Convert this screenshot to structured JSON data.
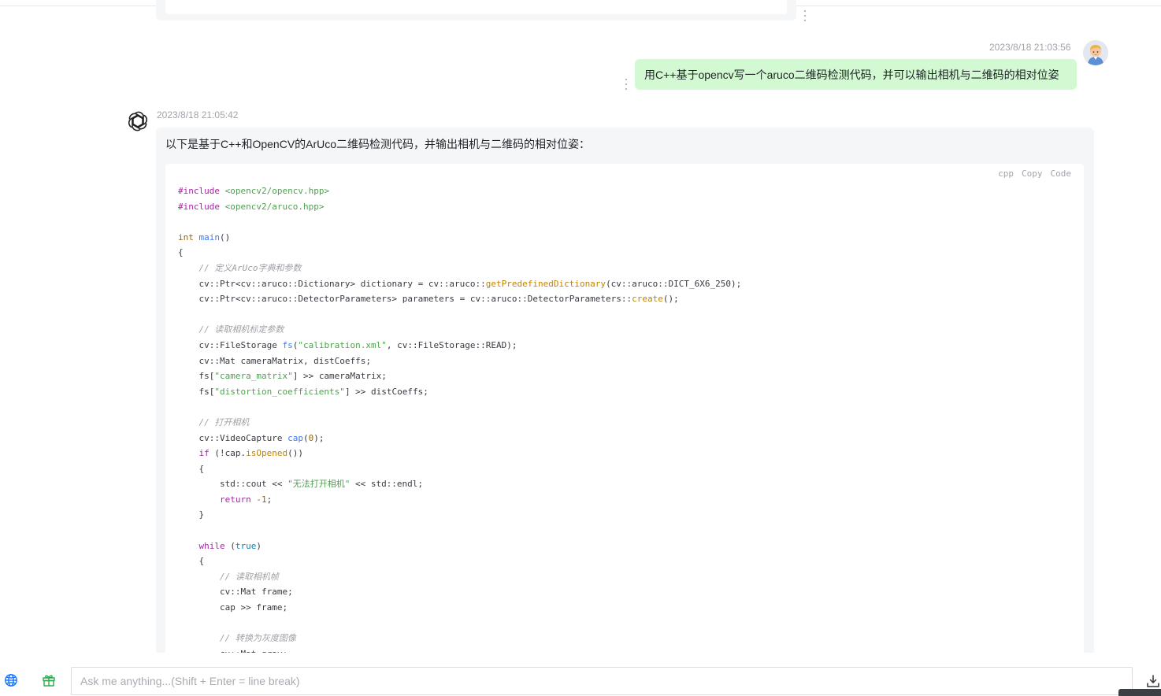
{
  "previous_message": {},
  "user_message": {
    "timestamp": "2023/8/18 21:03:56",
    "text": "用C++基于opencv写一个aruco二维码检测代码，并可以输出相机与二维码的相对位姿",
    "bubble_color": "#d2f9d1"
  },
  "bot_message": {
    "timestamp": "2023/8/18 21:05:42",
    "intro": "以下是基于C++和OpenCV的ArUco二维码检测代码，并输出相机与二维码的相对位姿：",
    "code": {
      "language_label": "cpp",
      "copy_label": "Copy",
      "code_label": "Code",
      "lines": [
        [
          [
            "kw",
            "#include"
          ],
          [
            "p",
            " "
          ],
          [
            "str",
            "<opencv2/opencv.hpp>"
          ]
        ],
        [
          [
            "kw",
            "#include"
          ],
          [
            "p",
            " "
          ],
          [
            "str",
            "<opencv2/aruco.hpp>"
          ]
        ],
        [],
        [
          [
            "type",
            "int"
          ],
          [
            "p",
            " "
          ],
          [
            "fn",
            "main"
          ],
          [
            "p",
            "()"
          ]
        ],
        [
          [
            "p",
            "{"
          ]
        ],
        [
          [
            "p",
            "    "
          ],
          [
            "com",
            "// 定义ArUco字典和参数"
          ]
        ],
        [
          [
            "p",
            "    cv::Ptr<cv::aruco::Dictionary> dictionary = cv::aruco::"
          ],
          [
            "fn2",
            "getPredefinedDictionary"
          ],
          [
            "p",
            "(cv::aruco::DICT_6X6_250);"
          ]
        ],
        [
          [
            "p",
            "    cv::Ptr<cv::aruco::DetectorParameters> parameters = cv::aruco::DetectorParameters::"
          ],
          [
            "fn2",
            "create"
          ],
          [
            "p",
            "();"
          ]
        ],
        [],
        [
          [
            "p",
            "    "
          ],
          [
            "com",
            "// 读取相机标定参数"
          ]
        ],
        [
          [
            "p",
            "    cv::FileStorage "
          ],
          [
            "fn",
            "fs"
          ],
          [
            "p",
            "("
          ],
          [
            "str",
            "\"calibration.xml\""
          ],
          [
            "p",
            ", cv::FileStorage::READ);"
          ]
        ],
        [
          [
            "p",
            "    cv::Mat cameraMatrix, distCoeffs;"
          ]
        ],
        [
          [
            "p",
            "    fs["
          ],
          [
            "str",
            "\"camera_matrix\""
          ],
          [
            "p",
            "] >> cameraMatrix;"
          ]
        ],
        [
          [
            "p",
            "    fs["
          ],
          [
            "str",
            "\"distortion_coefficients\""
          ],
          [
            "p",
            "] >> distCoeffs;"
          ]
        ],
        [],
        [
          [
            "p",
            "    "
          ],
          [
            "com",
            "// 打开相机"
          ]
        ],
        [
          [
            "p",
            "    cv::VideoCapture "
          ],
          [
            "fn",
            "cap"
          ],
          [
            "p",
            "("
          ],
          [
            "num",
            "0"
          ],
          [
            "p",
            ");"
          ]
        ],
        [
          [
            "p",
            "    "
          ],
          [
            "kw",
            "if"
          ],
          [
            "p",
            " (!cap."
          ],
          [
            "fn2",
            "isOpened"
          ],
          [
            "p",
            "())"
          ]
        ],
        [
          [
            "p",
            "    {"
          ]
        ],
        [
          [
            "p",
            "        std::cout << "
          ],
          [
            "str",
            "\"无法打开相机\""
          ],
          [
            "p",
            " << std::endl;"
          ]
        ],
        [
          [
            "p",
            "        "
          ],
          [
            "kw",
            "return"
          ],
          [
            "p",
            " "
          ],
          [
            "num",
            "-1"
          ],
          [
            "p",
            ";"
          ]
        ],
        [
          [
            "p",
            "    }"
          ]
        ],
        [],
        [
          [
            "p",
            "    "
          ],
          [
            "kw",
            "while"
          ],
          [
            "p",
            " ("
          ],
          [
            "lit",
            "true"
          ],
          [
            "p",
            ")"
          ]
        ],
        [
          [
            "p",
            "    {"
          ]
        ],
        [
          [
            "p",
            "        "
          ],
          [
            "com",
            "// 读取相机帧"
          ]
        ],
        [
          [
            "p",
            "        cv::Mat frame;"
          ]
        ],
        [
          [
            "p",
            "        cap >> frame;"
          ]
        ],
        [],
        [
          [
            "p",
            "        "
          ],
          [
            "com",
            "// 转换为灰度图像"
          ]
        ],
        [
          [
            "p",
            "        cv::Mat gray;"
          ]
        ]
      ]
    }
  },
  "input_bar": {
    "placeholder": "Ask me anything...(Shift + Enter = line break)",
    "value": ""
  },
  "icons": {
    "globe": "globe-icon",
    "gift": "gift-icon",
    "download": "download-icon",
    "more": "more-vertical-icon",
    "bot_logo": "openai-logo-icon",
    "user_avatar": "user-avatar-icon"
  },
  "colors": {
    "accent": "#1677ff",
    "gift": "#2fa84f",
    "bot_bubble": "#f4f6f8",
    "user_bubble": "#d2f9d1"
  }
}
